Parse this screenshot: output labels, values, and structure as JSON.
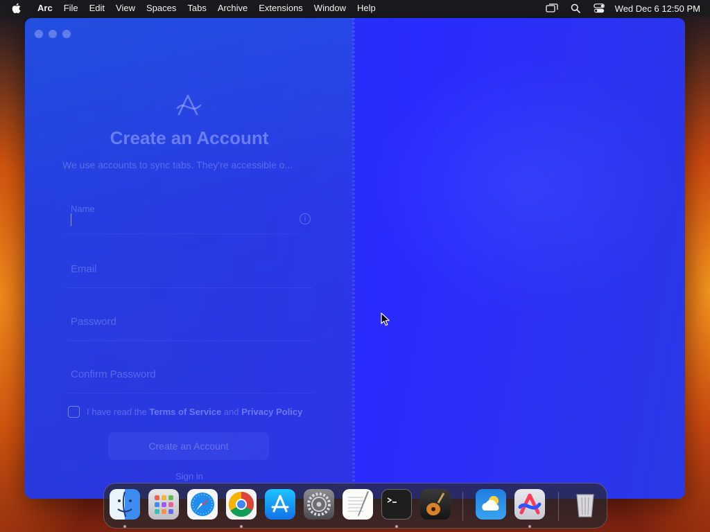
{
  "menubar": {
    "app_name": "Arc",
    "items": [
      "File",
      "Edit",
      "View",
      "Spaces",
      "Tabs",
      "Archive",
      "Extensions",
      "Window",
      "Help"
    ],
    "status_icons": [
      "screen-mirroring-icon",
      "spotlight-search-icon",
      "control-center-icon"
    ],
    "clock": "Wed Dec 6  12:50 PM"
  },
  "window": {
    "app": "Arc",
    "form": {
      "title": "Create an Account",
      "subtitle": "We use accounts to sync tabs. They're accessible o...",
      "name_placeholder": "Name",
      "email_placeholder": "Email",
      "password_placeholder": "Password",
      "confirm_password_placeholder": "Confirm Password",
      "terms_prefix": "I have read the",
      "terms_of_service": "Terms of Service",
      "terms_and": "and",
      "privacy_policy": "Privacy Policy",
      "create_button": "Create an Account",
      "sign_in": "Sign in"
    }
  },
  "dock": {
    "items": [
      {
        "name": "Finder",
        "icon": "finder-icon",
        "running": true
      },
      {
        "name": "Launchpad",
        "icon": "launchpad-icon",
        "running": false
      },
      {
        "name": "Safari",
        "icon": "safari-icon",
        "running": false
      },
      {
        "name": "Google Chrome",
        "icon": "chrome-icon",
        "running": true
      },
      {
        "name": "App Store",
        "icon": "app-store-icon",
        "running": false
      },
      {
        "name": "System Settings",
        "icon": "system-settings-icon",
        "running": false
      },
      {
        "name": "TextEdit",
        "icon": "textedit-icon",
        "running": false
      },
      {
        "name": "Terminal",
        "icon": "terminal-icon",
        "running": true
      },
      {
        "name": "GarageBand",
        "icon": "garageband-icon",
        "running": false
      },
      {
        "name": "Weather",
        "icon": "weather-icon",
        "running": false
      },
      {
        "name": "Arc",
        "icon": "arc-icon",
        "running": true
      },
      {
        "name": "Trash",
        "icon": "trash-icon",
        "running": false
      }
    ]
  },
  "colors": {
    "arc_blue": "#2a2bff",
    "menubar_bg": "#1c1c20"
  }
}
